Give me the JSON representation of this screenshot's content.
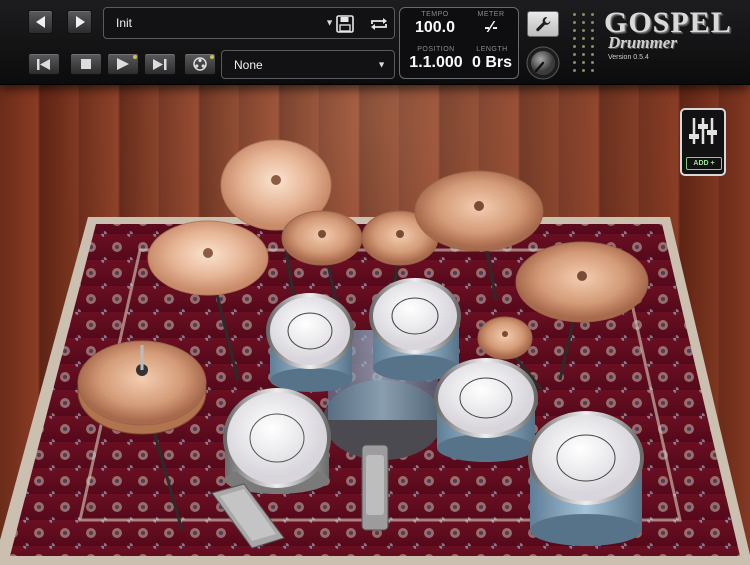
{
  "transport": {
    "preset_name": "Init",
    "pattern_name": "None"
  },
  "info": {
    "tempo_label": "TEMPO",
    "tempo_value": "100.0",
    "meter_label": "METER",
    "meter_value": "-∕-",
    "position_label": "POSITION",
    "position_value": "1.1.000",
    "length_label": "LENGTH",
    "length_value": "0 Brs"
  },
  "logo": {
    "line1": "GOSPEL",
    "line2": "Drummer",
    "version": "Version 0.5.4"
  },
  "mixer": {
    "add_label": "ADD +"
  },
  "icons": {
    "prev": "arrow-left-icon",
    "next": "arrow-right-icon",
    "save": "floppy-disk-icon",
    "loop": "loop-icon",
    "rewind": "rewind-icon",
    "stop": "stop-icon",
    "play": "play-icon",
    "forward": "skip-forward-icon",
    "reel": "reel-icon",
    "settings": "wrench-icon",
    "knob": "volume-knob-icon",
    "mixer": "mixer-sliders-icon"
  },
  "colors": {
    "led_green": "#7ed07e",
    "floor_wood": "#7e3720",
    "rug_red": "#7a1024",
    "shell_blue": "#7f9db8"
  }
}
